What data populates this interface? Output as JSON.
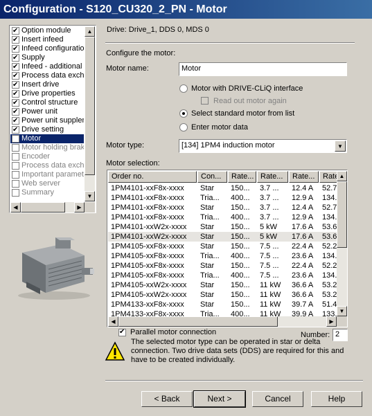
{
  "window": {
    "title": "Configuration - S120_CU320_2_PN - Motor"
  },
  "sidebar": {
    "items": [
      {
        "label": "Option module",
        "checked": true,
        "selected": false
      },
      {
        "label": "Insert infeed",
        "checked": true,
        "selected": false
      },
      {
        "label": "Infeed configuration",
        "checked": true,
        "selected": false
      },
      {
        "label": "Supply",
        "checked": true,
        "selected": false
      },
      {
        "label": "Infeed - additional d",
        "checked": true,
        "selected": false
      },
      {
        "label": "Process data excha",
        "checked": true,
        "selected": false
      },
      {
        "label": "Insert drive",
        "checked": true,
        "selected": false
      },
      {
        "label": "Drive properties",
        "checked": true,
        "selected": false
      },
      {
        "label": "Control structure",
        "checked": true,
        "selected": false
      },
      {
        "label": "Power unit",
        "checked": true,
        "selected": false
      },
      {
        "label": "Power unit supplem",
        "checked": true,
        "selected": false
      },
      {
        "label": "Drive setting",
        "checked": true,
        "selected": false
      },
      {
        "label": "Motor",
        "checked": false,
        "selected": true
      },
      {
        "label": "Motor holding brake",
        "checked": false,
        "selected": false
      },
      {
        "label": "Encoder",
        "checked": false,
        "selected": false
      },
      {
        "label": "Process data excha",
        "checked": false,
        "selected": false
      },
      {
        "label": "Important paramete",
        "checked": false,
        "selected": false
      },
      {
        "label": "Web server",
        "checked": false,
        "selected": false
      },
      {
        "label": "Summary",
        "checked": false,
        "selected": false
      }
    ]
  },
  "main": {
    "drive_info": "Drive: Drive_1, DDS 0, MDS 0",
    "configure_label": "Configure the motor:",
    "motor_name_label": "Motor name:",
    "motor_name_value": "Motor",
    "radio_driveclIq": "Motor with DRIVE-CLiQ interface",
    "checkbox_readout": "Read out motor again",
    "radio_standard": "Select standard motor from list",
    "radio_enter": "Enter motor data",
    "motor_type_label": "Motor type:",
    "motor_type_value": "[134] 1PM4 induction motor",
    "motor_selection_label": "Motor selection:",
    "grid": {
      "headers": [
        "Order no.",
        "Con...",
        "Rate...",
        "Rate...",
        "Rate...",
        "Rate"
      ],
      "rows": [
        [
          "1PM4101-xxF8x-xxxx",
          "Star",
          "150...",
          "3.7 ...",
          "12.4 A",
          "52.7"
        ],
        [
          "1PM4101-xxF8x-xxxx",
          "Tria...",
          "400...",
          "3.7 ...",
          "12.9 A",
          "134."
        ],
        [
          "1PM4101-xxF8x-xxxx",
          "Star",
          "150...",
          "3.7 ...",
          "12.4 A",
          "52.7"
        ],
        [
          "1PM4101-xxF8x-xxxx",
          "Tria...",
          "400...",
          "3.7 ...",
          "12.9 A",
          "134."
        ],
        [
          "1PM4101-xxW2x-xxxx",
          "Star",
          "150...",
          "5 kW",
          "17.6 A",
          "53.6"
        ],
        [
          "1PM4101-xxW2x-xxxx",
          "Star",
          "150...",
          "5 kW",
          "17.6 A",
          "53.6"
        ],
        [
          "1PM4105-xxF8x-xxxx",
          "Star",
          "150...",
          "7.5 ...",
          "22.4 A",
          "52.2"
        ],
        [
          "1PM4105-xxF8x-xxxx",
          "Tria...",
          "400...",
          "7.5 ...",
          "23.6 A",
          "134."
        ],
        [
          "1PM4105-xxF8x-xxxx",
          "Star",
          "150...",
          "7.5 ...",
          "22.4 A",
          "52.2"
        ],
        [
          "1PM4105-xxF8x-xxxx",
          "Tria...",
          "400...",
          "7.5 ...",
          "23.6 A",
          "134."
        ],
        [
          "1PM4105-xxW2x-xxxx",
          "Star",
          "150...",
          "11 kW",
          "36.6 A",
          "53.2"
        ],
        [
          "1PM4105-xxW2x-xxxx",
          "Star",
          "150...",
          "11 kW",
          "36.6 A",
          "53.2"
        ],
        [
          "1PM4133-xxF8x-xxxx",
          "Star",
          "150...",
          "11 kW",
          "39.7 A",
          "51.4"
        ],
        [
          "1PM4133-xxF8x-xxxx",
          "Tria...",
          "400...",
          "11 kW",
          "39.9 A",
          "133."
        ]
      ],
      "selected_row": 5
    },
    "parallel_label": "Parallel motor connection",
    "number_label": "Number:",
    "number_value": "2",
    "warning_text": "The selected motor type can be operated in star or delta connection. Two drive data sets (DDS) are required for this and have to be created individually."
  },
  "buttons": {
    "back": "< Back",
    "next": "Next >",
    "cancel": "Cancel",
    "help": "Help"
  }
}
